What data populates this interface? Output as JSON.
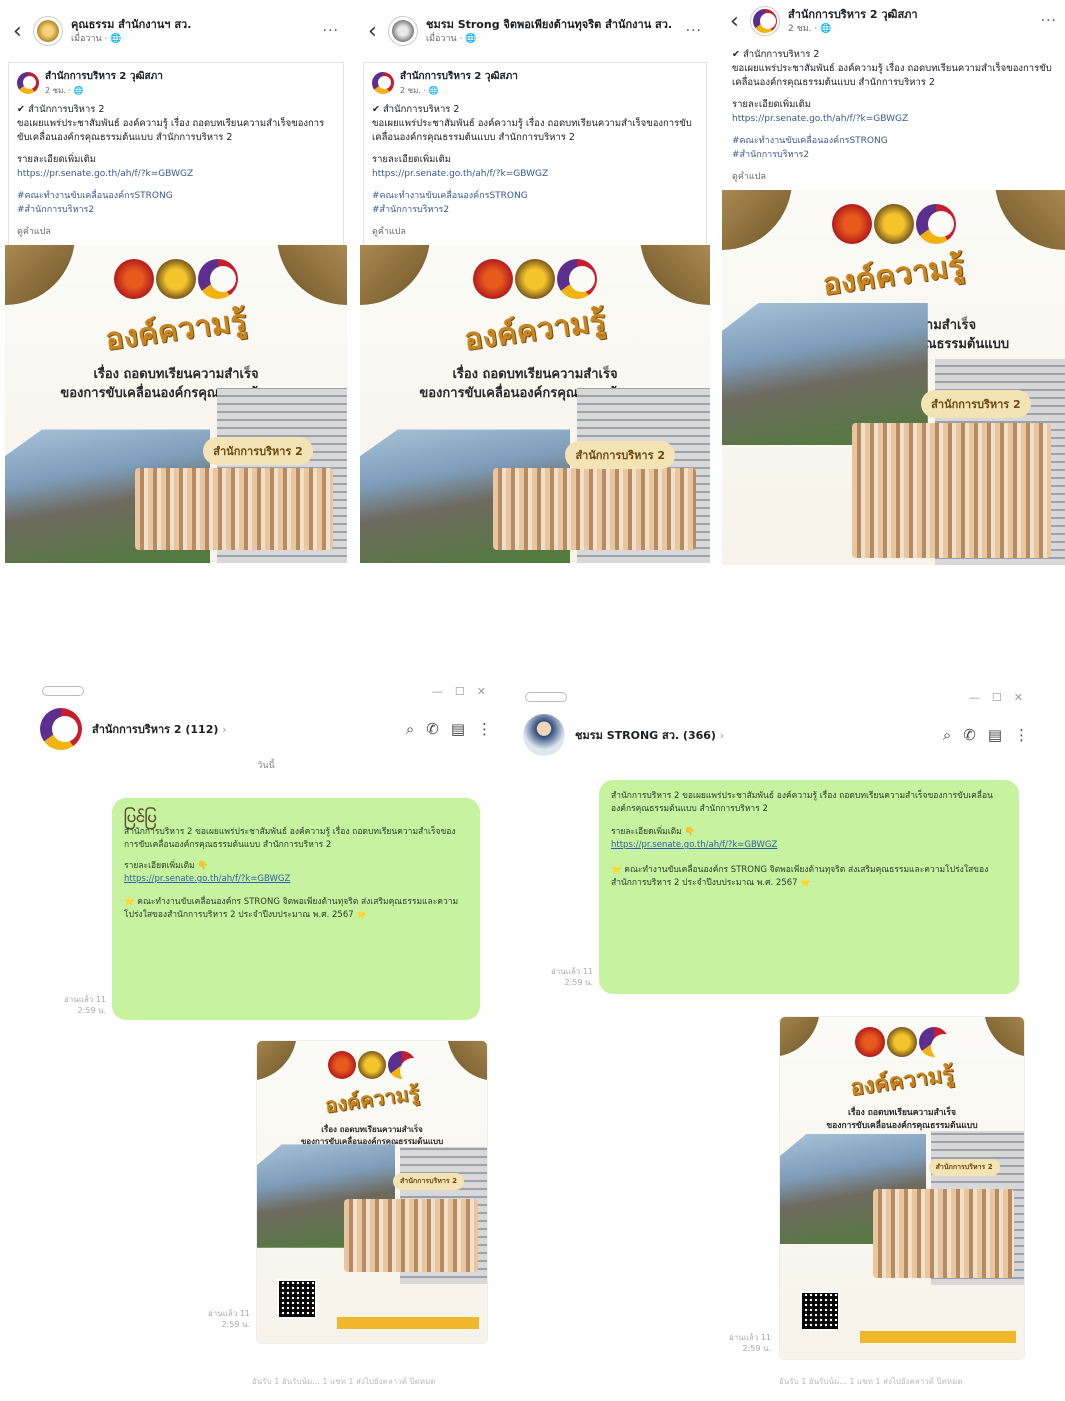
{
  "panels": [
    {
      "top": {
        "back_icon": "chevron-left-icon",
        "page_name": "คุณธรรม สำนักงานฯ สว.",
        "page_meta": "เมื่อวาน · 🌐",
        "more": "···"
      },
      "post": {
        "author": "สำนักการบริหาร 2 วุฒิสภา",
        "meta": "2 ชม. · 🌐",
        "lines": [
          "✔ สำนักการบริหาร 2",
          "ขอเผยแพร่ประชาสัมพันธ์ องค์ความรู้ เรื่อง ถอดบทเรียนความสำเร็จของการขับเคลื่อนองค์กรคุณธรรมต้นแบบ สำนักการบริหาร 2"
        ],
        "detail_label": "รายละเอียดเพิ่มเติม",
        "link": "https://pr.senate.go.th/ah/f/?k=GBWGZ",
        "tags": [
          "#คณะทำงานขับเคลื่อนองค์กรSTRONG",
          "#สำนักการบริหาร2"
        ],
        "see": "ดูคำแปล"
      }
    },
    {
      "top": {
        "back_icon": "chevron-left-icon",
        "page_name": "ชมรม Strong จิตพอเพียงต้านทุจริต สำนักงาน สว.",
        "page_meta": "เมื่อวาน · 🌐",
        "more": "···"
      },
      "post": {
        "author": "สำนักการบริหาร 2 วุฒิสภา",
        "meta": "2 ชม. · 🌐",
        "lines": [
          "✔ สำนักการบริหาร 2",
          "ขอเผยแพร่ประชาสัมพันธ์ องค์ความรู้ เรื่อง ถอดบทเรียนความสำเร็จของการขับเคลื่อนองค์กรคุณธรรมต้นแบบ สำนักการบริหาร 2"
        ],
        "detail_label": "รายละเอียดเพิ่มเติม",
        "link": "https://pr.senate.go.th/ah/f/?k=GBWGZ",
        "tags": [
          "#คณะทำงานขับเคลื่อนองค์กรSTRONG",
          "#สำนักการบริหาร2"
        ],
        "see": "ดูคำแปล"
      }
    },
    {
      "top": {
        "back_icon": "chevron-left-icon",
        "page_name": "สำนักการบริหาร 2 วุฒิสภา",
        "page_meta": "2 ชม. · 🌐",
        "more": "···"
      },
      "post": {
        "author": "",
        "meta": "",
        "lines": [
          "✔ สำนักการบริหาร 2",
          "ขอเผยแพร่ประชาสัมพันธ์ องค์ความรู้ เรื่อง ถอดบทเรียนความสำเร็จของการขับเคลื่อนองค์กรคุณธรรมต้นแบบ สำนักการบริหาร 2"
        ],
        "detail_label": "รายละเอียดเพิ่มเติม",
        "link": "https://pr.senate.go.th/ah/f/?k=GBWGZ",
        "tags": [
          "#คณะทำงานขับเคลื่อนองค์กรSTRONG",
          "#สำนักการบริหาร2"
        ],
        "see": "ดูคำแปล"
      }
    }
  ],
  "poster": {
    "heading": "องค์ความรู้",
    "sub1": "เรื่อง ถอดบทเรียนความสำเร็จ",
    "sub2": "ของการขับเคลื่อนองค์กรคุณธรรมต้นแบบ",
    "badge": "สำนักการบริหาร 2"
  },
  "chats": [
    {
      "title": "สำนักการบริหาร 2 (112)",
      "chevron": "›",
      "day": "วันนี้",
      "sticker": "ပြင်ပြ",
      "msg_lines": [
        "สำนักการบริหาร 2 ขอเผยแพร่ประชาสัมพันธ์ องค์ความรู้ เรื่อง ถอดบทเรียนความสำเร็จของการขับเคลื่อนองค์กรคุณธรรมต้นแบบ สำนักการบริหาร 2"
      ],
      "detail_label": "รายละเอียดเพิ่มเติม 👇",
      "link": "https://pr.senate.go.th/ah/f/?k=GBWGZ",
      "note": "⭐ คณะทำงานขับเคลื่อนองค์กร STRONG จิตพอเพียงต้านทุจริต ส่งเสริมคุณธรรมและความโปร่งใสของสำนักการบริหาร 2 ประจำปีงบประมาณ พ.ศ. 2567 ⭐",
      "stamp1": "อ่านแล้ว 11\n2:59 น.",
      "stamp2": "อ่านแล้ว 11\n2:59 น.",
      "footer": "อันรับ 1 อันรับน้ม... 1 แชท 1 ส่งไปยังคลาวด์ ปิดหมด"
    },
    {
      "title": "ชมรม STRONG สว. (366)",
      "chevron": "›",
      "msg_lines": [
        "สำนักการบริหาร 2 ขอเผยแพร่ประชาสัมพันธ์ องค์ความรู้ เรื่อง ถอดบทเรียนความสำเร็จของการขับเคลื่อนองค์กรคุณธรรมต้นแบบ สำนักการบริหาร 2"
      ],
      "detail_label": "รายละเอียดเพิ่มเติม 👇",
      "link": "https://pr.senate.go.th/ah/f/?k=GBWGZ",
      "note": "⭐ คณะทำงานขับเคลื่อนองค์กร STRONG จิตพอเพียงต้านทุจริต ส่งเสริมคุณธรรมและความโปร่งใสของสำนักการบริหาร 2 ประจำปีงบประมาณ พ.ศ. 2567 ⭐",
      "stamp1": "อ่านแล้ว 11\n2:59 น.",
      "stamp2": "อ่านแล้ว 11\n2:59 น.",
      "footer": "อันรับ 1 อันรับน้ม... 1 แชท 1 ส่งไปยังคลาวด์ ปิดหมด"
    }
  ],
  "window_controls": {
    "minimize": "—",
    "maximize": "☐",
    "close": "✕"
  },
  "icons": {
    "search": "search-icon",
    "call": "phone-icon",
    "notes": "notes-icon",
    "menu": "kebab-menu-icon"
  },
  "colors": {
    "bubble": "#c7f3a1",
    "link": "#385898",
    "poster_gold": "#c9861f",
    "badge": "#f4e3b5"
  }
}
